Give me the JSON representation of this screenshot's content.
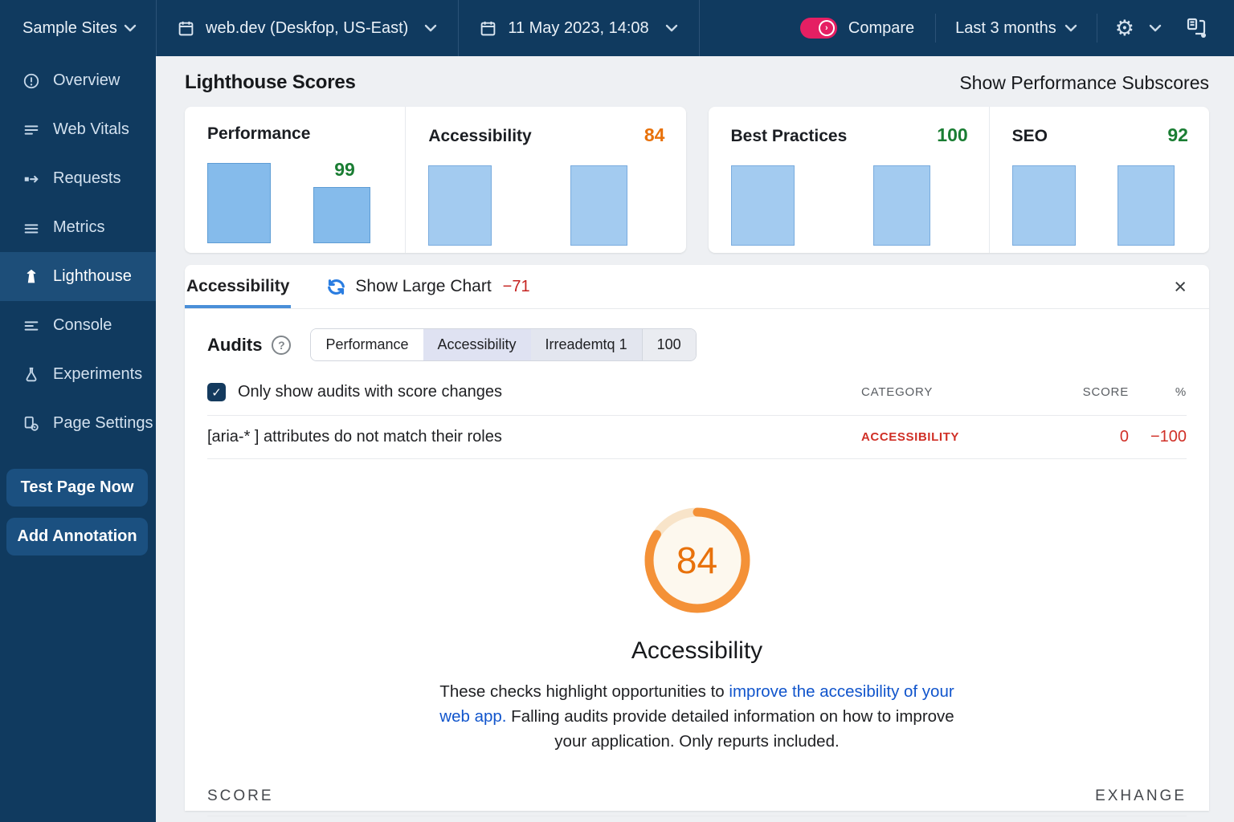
{
  "colors": {
    "navy": "#103A5F",
    "navy_selected": "#1D4E79",
    "accent_pink": "#E51F63",
    "green": "#1A7D33",
    "orange": "#E8710A",
    "red": "#D03027",
    "delta_red": "#C5221F",
    "bar_blue": "#85BBEB",
    "bar_blue_light": "#A3CBF0",
    "link_blue": "#1155CC",
    "tab_underline": "#4A8FD8",
    "sync_blue": "#2A7DE1"
  },
  "icons": {
    "gear": "⚙",
    "close": "×",
    "check": "✓",
    "help": "?"
  },
  "topbar": {
    "site_group": "Sample Sites",
    "page_select": "web.dev (Deskfop, US-East)",
    "date_select": "11 May 2023, 14:08",
    "compare_label": "Compare",
    "compare_on": true,
    "range_select": "Last 3 months"
  },
  "sidebar": {
    "items": [
      {
        "label": "Overview",
        "icon": "info-icon",
        "selected": false
      },
      {
        "label": "Web Vitals",
        "icon": "list-icon",
        "selected": false
      },
      {
        "label": "Requests",
        "icon": "request-arrow-icon",
        "selected": false
      },
      {
        "label": "Metrics",
        "icon": "lines-icon",
        "selected": false
      },
      {
        "label": "Lighthouse",
        "icon": "lighthouse-icon",
        "selected": true
      },
      {
        "label": "Console",
        "icon": "console-icon",
        "selected": false
      },
      {
        "label": "Experiments",
        "icon": "flask-icon",
        "selected": false
      },
      {
        "label": "Page Settings",
        "icon": "page-gear-icon",
        "selected": false
      }
    ],
    "buttons": [
      {
        "label": "Test Page Now"
      },
      {
        "label": "Add Annotation"
      }
    ]
  },
  "header": {
    "title": "Lighthouse Scores",
    "action": "Show Performance Subscores"
  },
  "scorecards": [
    {
      "title": "Performance",
      "score": "99",
      "score_color": "green",
      "bars": [
        100,
        70
      ],
      "score_position": "above-second-bar"
    },
    {
      "title": "Accessibility",
      "score": "84",
      "score_color": "orange",
      "bars": [
        100,
        100
      ],
      "score_position": "header"
    },
    {
      "title": "Best Practices",
      "score": "100",
      "score_color": "green",
      "bars": [
        100,
        100
      ],
      "score_position": "header"
    },
    {
      "title": "SEO",
      "score": "92",
      "score_color": "green",
      "bars": [
        100,
        100
      ],
      "score_position": "header"
    }
  ],
  "detail_panel": {
    "tab": "Accessibility",
    "show_large_chart": "Show Large Chart",
    "delta": "−71",
    "audits": {
      "label": "Audits",
      "segments": [
        "Performance",
        "Accessibility",
        "Irreademtq 1",
        "100"
      ],
      "selected_segment": "Accessibility"
    },
    "filter": {
      "label": "Only show audits with score changes",
      "checked": true
    },
    "table": {
      "category_header": "CATEGORY",
      "score_header": "SCORE",
      "pct_header": "%",
      "rows": [
        {
          "audit": "[aria-* ] attributes do not match their roles",
          "category": "ACCESSIBILITY",
          "score": "0",
          "pct": "−100"
        }
      ]
    },
    "gauge": {
      "value": "84",
      "percent": 84,
      "label": "Accessibility"
    },
    "description": {
      "before_link": "These checks highlight opportunities to ",
      "link": "improve the accesibility of your web app.",
      "after_link": " Falling audits provide detailed information on how to improve your application. Only repurts included."
    },
    "footer": {
      "left": "SCORE",
      "right": "EXHANGE"
    }
  },
  "chart_data": [
    {
      "type": "bar",
      "title": "Performance",
      "categories": [
        "bar_1",
        "bar_2"
      ],
      "values": [
        100,
        70
      ],
      "data_label": "99"
    },
    {
      "type": "bar",
      "title": "Accessibility",
      "categories": [
        "bar_1",
        "bar_2"
      ],
      "values": [
        100,
        100
      ],
      "score": 84
    },
    {
      "type": "bar",
      "title": "Best Practices",
      "categories": [
        "bar_1",
        "bar_2"
      ],
      "values": [
        100,
        100
      ],
      "score": 100
    },
    {
      "type": "bar",
      "title": "SEO",
      "categories": [
        "bar_1",
        "bar_2"
      ],
      "values": [
        100,
        100
      ],
      "score": 92
    },
    {
      "type": "gauge",
      "title": "Accessibility",
      "value": 84,
      "max": 100
    }
  ]
}
